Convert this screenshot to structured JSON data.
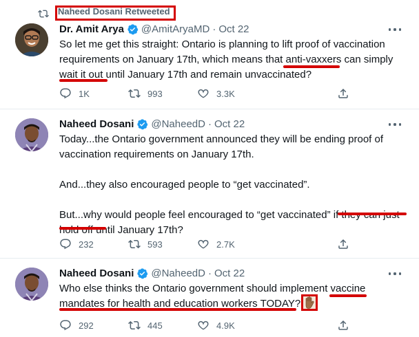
{
  "retweet_banner": {
    "label": "Naheed Dosani Retweeted"
  },
  "tweets": [
    {
      "name": "Dr. Amit Arya",
      "handle": "@AmitAryaMD",
      "date": "Oct 22",
      "lines": [
        "So let me get this straight: Ontario is planning to lift proof of vaccination",
        "requirements on January 17th, which means that anti-vaxxers can simply",
        "wait it out until January 17th and remain unvaccinated?"
      ],
      "actions": {
        "reply": "1K",
        "retweet": "993",
        "like": "3.3K"
      }
    },
    {
      "name": "Naheed Dosani",
      "handle": "@NaheedD",
      "date": "Oct 22",
      "lines": [
        "Today...the Ontario government announced they will be ending proof of",
        "vaccination requirements on January 17th.",
        "",
        "And...they also encouraged people to “get vaccinated”.",
        "",
        "But...why would people feel encouraged to “get vaccinated” if they can just",
        "hold off until January 17th?"
      ],
      "actions": {
        "reply": "232",
        "retweet": "593",
        "like": "2.7K"
      }
    },
    {
      "name": "Naheed Dosani",
      "handle": "@NaheedD",
      "date": "Oct 22",
      "lines": [
        "Who else thinks the Ontario government should implement vaccine",
        "mandates for health and education workers TODAY?"
      ],
      "actions": {
        "reply": "292",
        "retweet": "445",
        "like": "4.9K"
      }
    }
  ],
  "colors": {
    "annotation": "#d40000",
    "verified": "#1d9bf0",
    "muted": "#536471"
  },
  "icons": [
    "retweet-icon",
    "verified-icon",
    "more-icon",
    "reply-icon",
    "like-icon",
    "share-icon",
    "raised-hand-icon"
  ]
}
